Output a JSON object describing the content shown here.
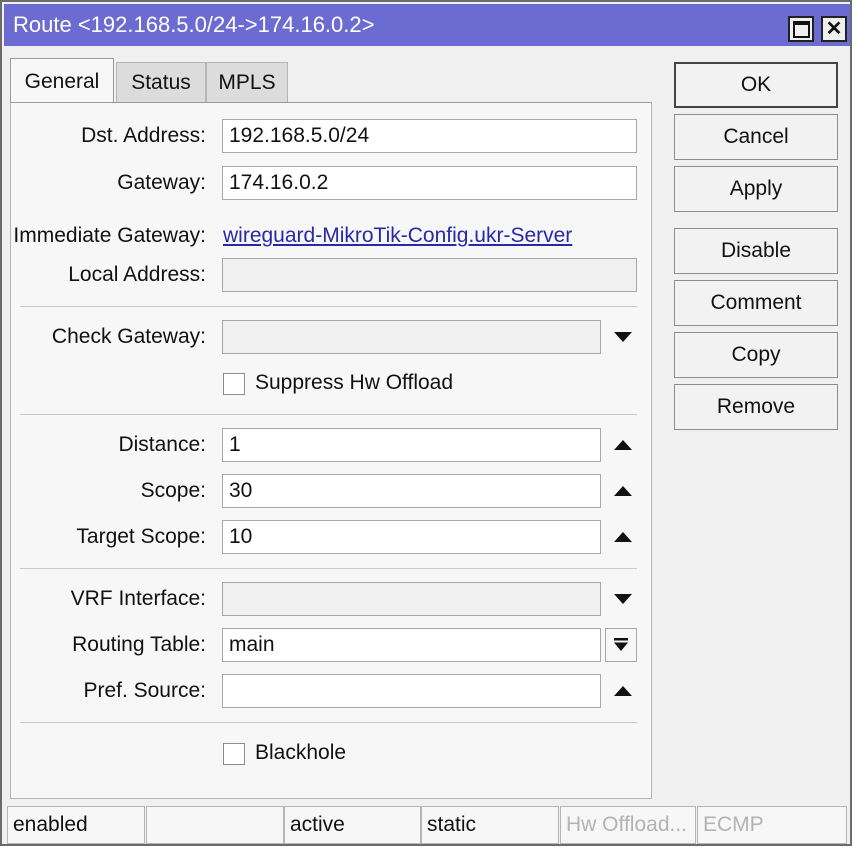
{
  "window": {
    "title": "Route <192.168.5.0/24->174.16.0.2>"
  },
  "tabs": [
    {
      "label": "General",
      "active": true
    },
    {
      "label": "Status",
      "active": false
    },
    {
      "label": "MPLS",
      "active": false
    }
  ],
  "form": {
    "dst_address": {
      "label": "Dst. Address:",
      "value": "192.168.5.0/24"
    },
    "gateway": {
      "label": "Gateway:",
      "value": "174.16.0.2"
    },
    "immediate_gateway": {
      "label": "Immediate Gateway:",
      "value": "wireguard-MikroTik-Config.ukr-Server"
    },
    "local_address": {
      "label": "Local Address:",
      "value": ""
    },
    "check_gateway": {
      "label": "Check Gateway:",
      "value": ""
    },
    "suppress_hw_offload": {
      "label": "Suppress Hw Offload",
      "checked": false
    },
    "distance": {
      "label": "Distance:",
      "value": "1"
    },
    "scope": {
      "label": "Scope:",
      "value": "30"
    },
    "target_scope": {
      "label": "Target Scope:",
      "value": "10"
    },
    "vrf_interface": {
      "label": "VRF Interface:",
      "value": ""
    },
    "routing_table": {
      "label": "Routing Table:",
      "value": "main"
    },
    "pref_source": {
      "label": "Pref. Source:",
      "value": ""
    },
    "blackhole": {
      "label": "Blackhole",
      "checked": false
    }
  },
  "buttons": {
    "ok": "OK",
    "cancel": "Cancel",
    "apply": "Apply",
    "disable": "Disable",
    "comment": "Comment",
    "copy": "Copy",
    "remove": "Remove"
  },
  "status_bar": {
    "state": "enabled",
    "empty": "",
    "active": "active",
    "type": "static",
    "hw_offload": "Hw Offload...",
    "ecmp": "ECMP"
  },
  "colors": {
    "titlebar": "#6b6bd2",
    "link": "#2929a8"
  }
}
